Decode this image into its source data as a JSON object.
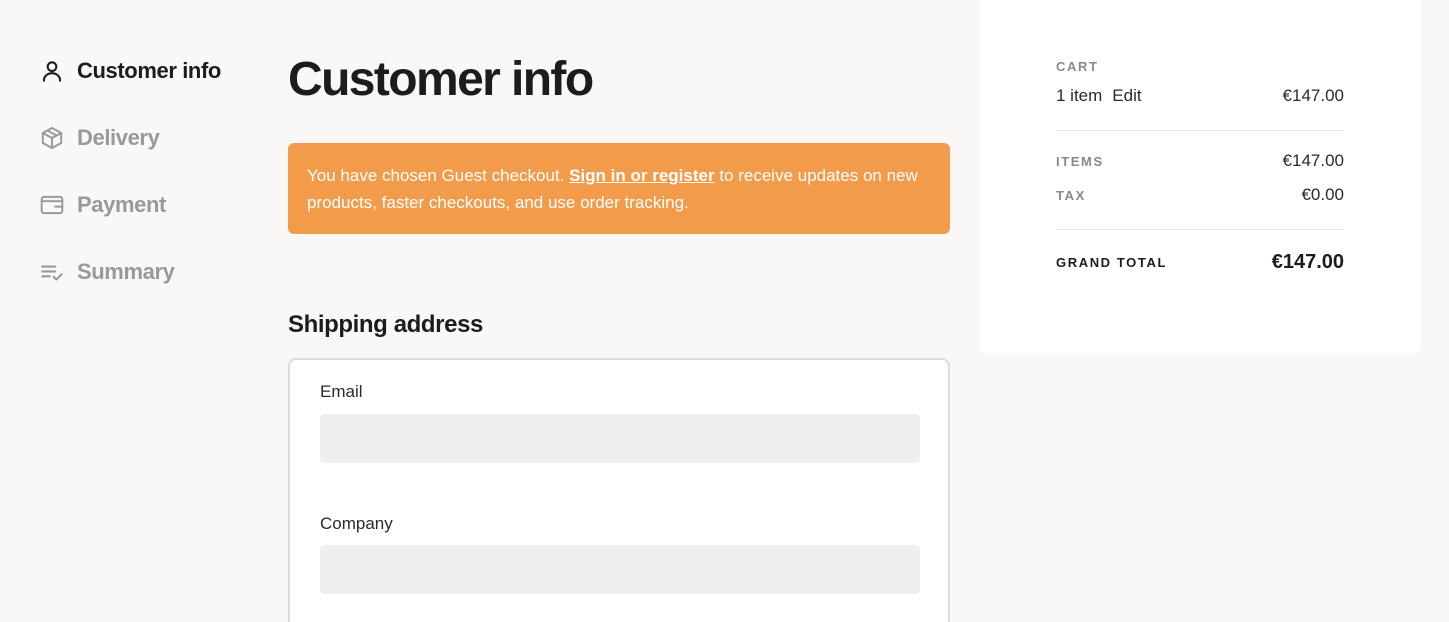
{
  "nav": {
    "steps": [
      {
        "label": "Customer info",
        "icon": "user-icon",
        "active": true
      },
      {
        "label": "Delivery",
        "icon": "box-icon",
        "active": false
      },
      {
        "label": "Payment",
        "icon": "wallet-icon",
        "active": false
      },
      {
        "label": "Summary",
        "icon": "list-check-icon",
        "active": false
      }
    ]
  },
  "main": {
    "title": "Customer info",
    "notice": {
      "prefix": "You have chosen Guest checkout. ",
      "link": "Sign in or register",
      "suffix": " to receive updates on new products, faster checkouts, and use order tracking.",
      "bg_color": "#f29b4b"
    },
    "shipping": {
      "title": "Shipping address",
      "email_label": "Email",
      "email_value": "",
      "company_label": "Company",
      "company_value": ""
    }
  },
  "cart": {
    "caption": "CART",
    "items_count": "1 item",
    "edit_label": "Edit",
    "cart_total": "€147.00",
    "items_label": "ITEMS",
    "items_value": "€147.00",
    "tax_label": "TAX",
    "tax_value": "€0.00",
    "grand_total_label": "GRAND TOTAL",
    "grand_total_value": "€147.00"
  }
}
